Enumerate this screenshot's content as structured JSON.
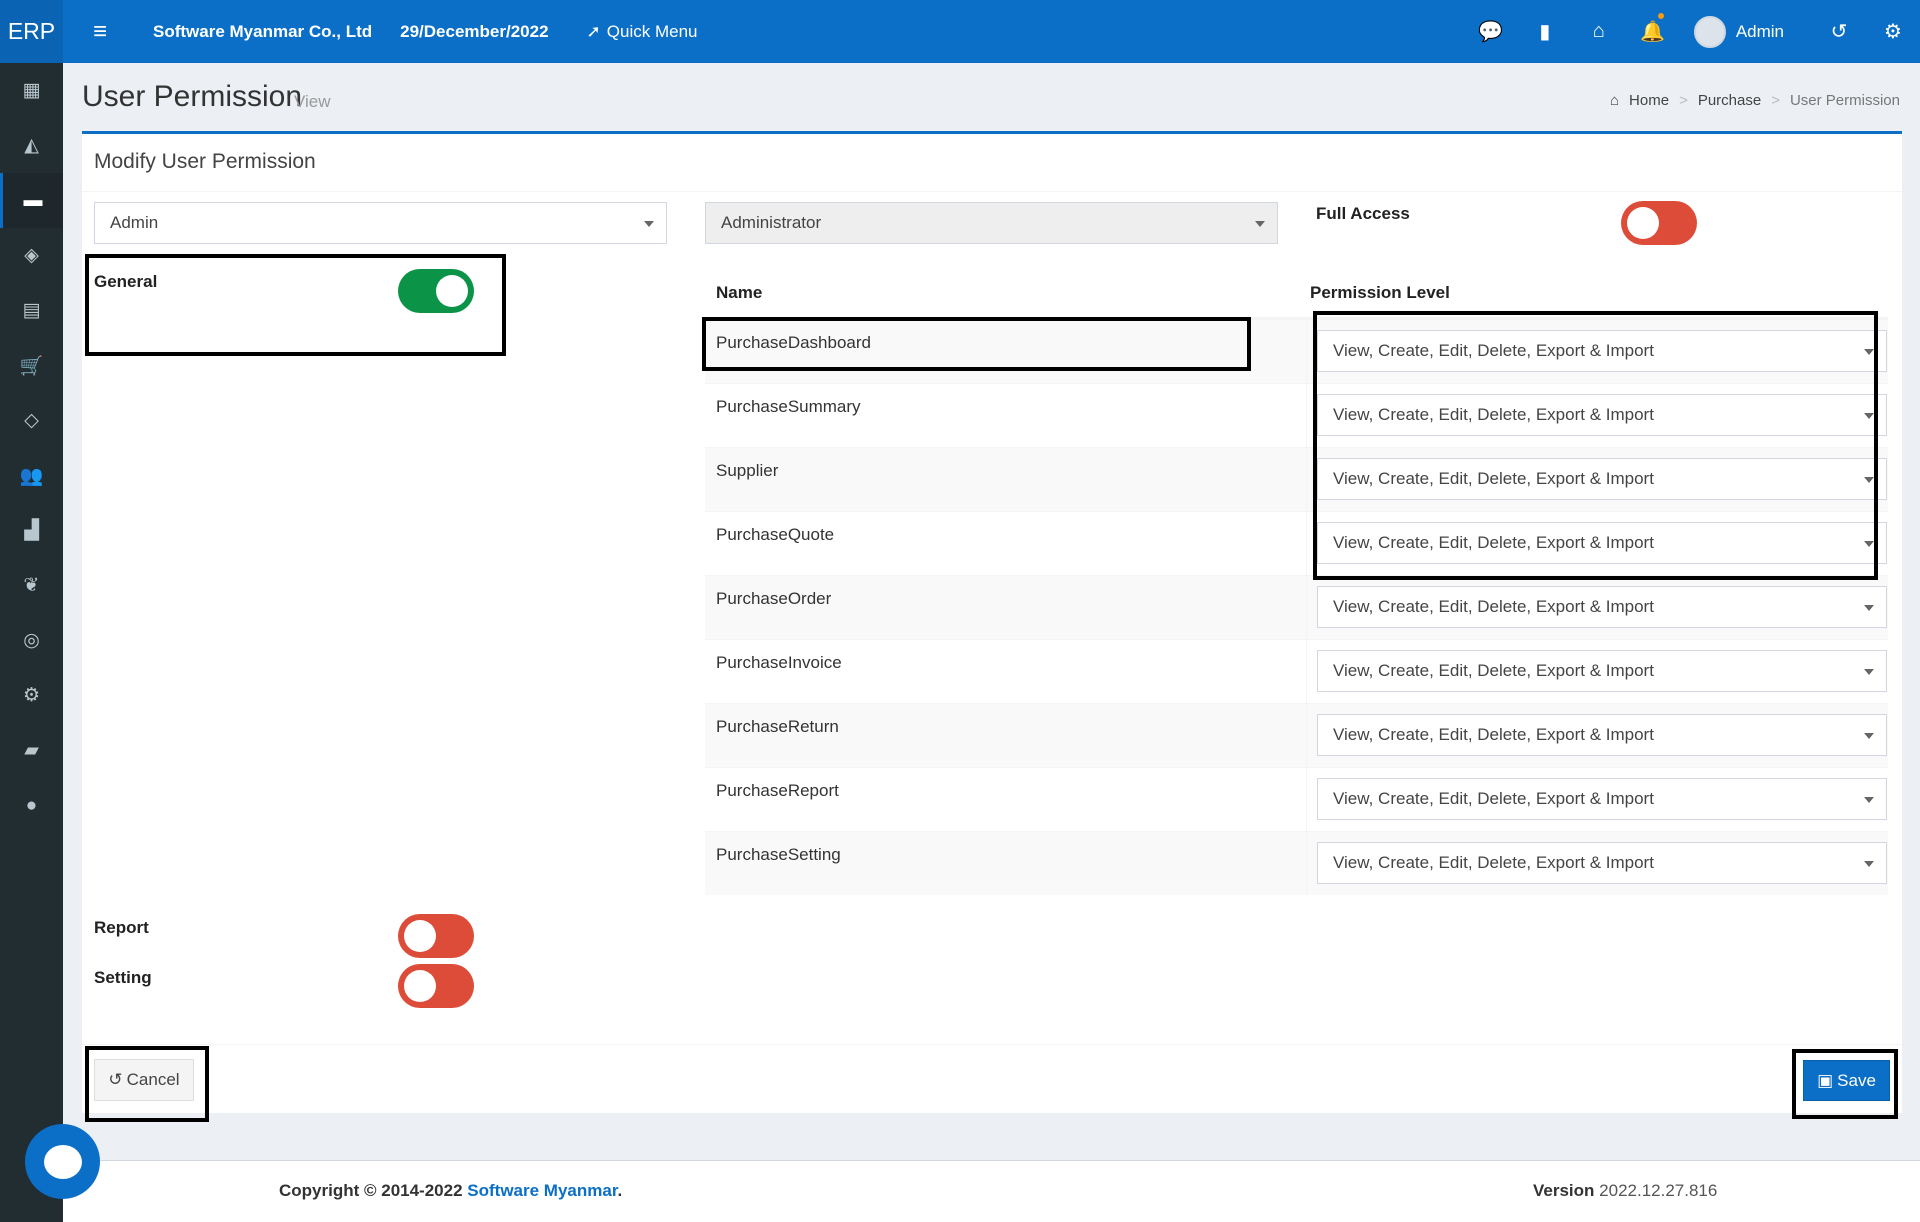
{
  "topbar": {
    "brand": "ERP",
    "company": "Software Myanmar Co., Ltd",
    "date": "29/December/2022",
    "quick_menu": "Quick Menu",
    "user": "Admin"
  },
  "header": {
    "title": "User Permission",
    "subtitle": "View",
    "breadcrumb": [
      "Home",
      "Purchase",
      "User Permission"
    ]
  },
  "box": {
    "title": "Modify User Permission",
    "user_select": "Admin",
    "role_select": "Administrator",
    "full_access_label": "Full Access",
    "full_access_on": false,
    "general_label": "General",
    "general_on": true,
    "report_label": "Report",
    "report_on": false,
    "setting_label": "Setting",
    "setting_on": false
  },
  "table": {
    "col_name": "Name",
    "col_level": "Permission Level",
    "rows": [
      {
        "name": "PurchaseDashboard",
        "level": "View, Create, Edit, Delete, Export & Import"
      },
      {
        "name": "PurchaseSummary",
        "level": "View, Create, Edit, Delete, Export & Import"
      },
      {
        "name": "Supplier",
        "level": "View, Create, Edit, Delete, Export & Import"
      },
      {
        "name": "PurchaseQuote",
        "level": "View, Create, Edit, Delete, Export & Import"
      },
      {
        "name": "PurchaseOrder",
        "level": "View, Create, Edit, Delete, Export & Import"
      },
      {
        "name": "PurchaseInvoice",
        "level": "View, Create, Edit, Delete, Export & Import"
      },
      {
        "name": "PurchaseReturn",
        "level": "View, Create, Edit, Delete, Export & Import"
      },
      {
        "name": "PurchaseReport",
        "level": "View, Create, Edit, Delete, Export & Import"
      },
      {
        "name": "PurchaseSetting",
        "level": "View, Create, Edit, Delete, Export & Import"
      }
    ]
  },
  "buttons": {
    "cancel": "Cancel",
    "save": "Save"
  },
  "footer": {
    "copyright": "Copyright © 2014-2022",
    "company_link": "Software Myanmar",
    "period": ".",
    "version_label": "Version",
    "version": "2022.12.27.816"
  },
  "colors": {
    "primary": "#0b6fc7",
    "sidebar": "#222d32",
    "toggle_on": "#0b9447",
    "toggle_off": "#dd4b39"
  }
}
